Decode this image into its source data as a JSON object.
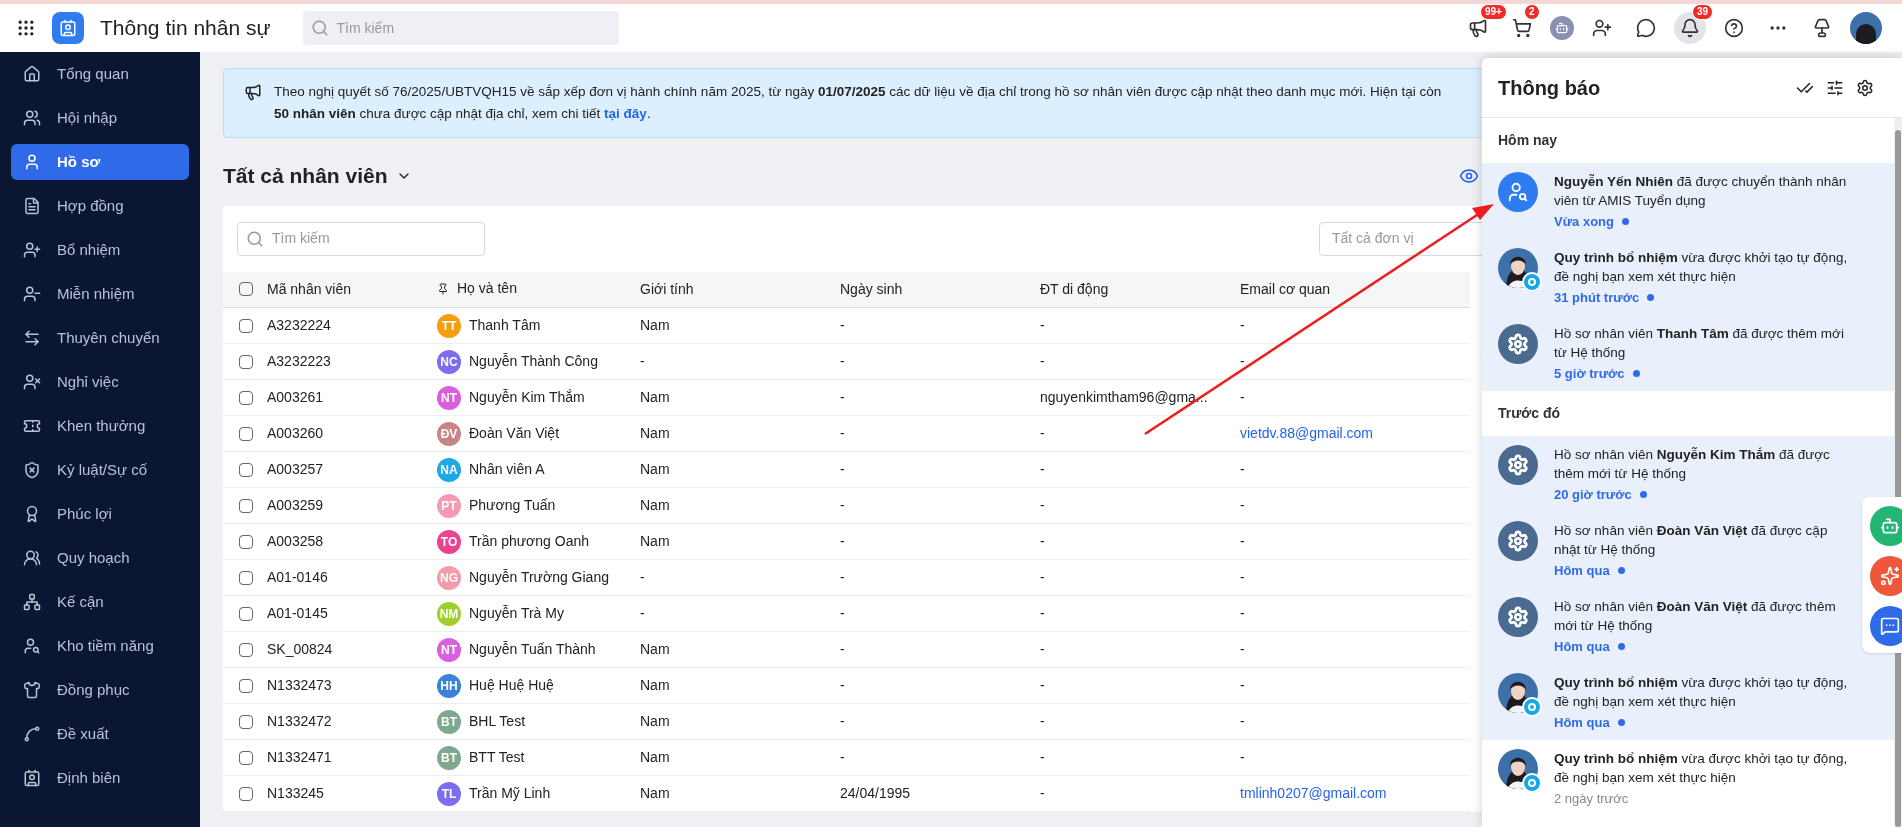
{
  "app": {
    "title": "Thông tin nhân sự",
    "search_placeholder": "Tìm kiếm"
  },
  "top_badges": {
    "announcements": "99+",
    "cart": "2",
    "notifications": "39"
  },
  "sidebar": {
    "items": [
      {
        "label": "Tổng quan",
        "selected": false
      },
      {
        "label": "Hội nhập",
        "selected": false
      },
      {
        "label": "Hồ sơ",
        "selected": true
      },
      {
        "label": "Hợp đồng",
        "selected": false
      },
      {
        "label": "Bổ nhiệm",
        "selected": false
      },
      {
        "label": "Miễn nhiệm",
        "selected": false
      },
      {
        "label": "Thuyên chuyển",
        "selected": false
      },
      {
        "label": "Nghỉ việc",
        "selected": false
      },
      {
        "label": "Khen thưởng",
        "selected": false
      },
      {
        "label": "Kỷ luật/Sự cố",
        "selected": false
      },
      {
        "label": "Phúc lợi",
        "selected": false
      },
      {
        "label": "Quy hoạch",
        "selected": false
      },
      {
        "label": "Kế cận",
        "selected": false
      },
      {
        "label": "Kho tiềm năng",
        "selected": false
      },
      {
        "label": "Đồng phục",
        "selected": false
      },
      {
        "label": "Đề xuất",
        "selected": false
      },
      {
        "label": "Định biên",
        "selected": false
      }
    ]
  },
  "banner": {
    "text": "Theo nghị quyết số 76/2025/UBTVQH15 về sắp xếp đơn vị hành chính năm 2025, từ ngày **01/07/2025** các dữ liệu về địa chỉ trong hồ sơ nhân viên được cập nhật theo danh mục mới. Hiện tại còn **50 nhân viên** chưa được cập nhật địa chỉ, xem chi tiết",
    "link": "tại đây",
    "end": "."
  },
  "view": {
    "title": "Tất cả nhân viên",
    "search_placeholder": "Tìm kiếm",
    "unit_filter": "Tất cả đơn vị"
  },
  "table": {
    "all_checked": false,
    "columns": [
      "Mã nhân viên",
      "Họ và tên",
      "Giới tính",
      "Ngày sinh",
      "ĐT di động",
      "Email cơ quan"
    ],
    "rows": [
      {
        "checked": false,
        "code": "A3232224",
        "initials": "TT",
        "color": "#f59e0b",
        "name": "Thanh Tâm",
        "gender": "Nam",
        "birth": "-",
        "phone": "-",
        "email": "-",
        "email_link": false
      },
      {
        "checked": false,
        "code": "A3232223",
        "initials": "NC",
        "color": "#7c6cf0",
        "name": "Nguyễn Thành Công",
        "gender": "-",
        "birth": "-",
        "phone": "-",
        "email": "-",
        "email_link": false
      },
      {
        "checked": false,
        "code": "A003261",
        "initials": "NT",
        "color": "#d95fe0",
        "name": "Nguyễn Kim Thắm",
        "gender": "Nam",
        "birth": "-",
        "phone": "nguyenkimtham96@gma...",
        "email": "-",
        "email_link": false
      },
      {
        "checked": false,
        "code": "A003260",
        "initials": "ĐV",
        "color": "#c98484",
        "name": "Đoàn Văn Việt",
        "gender": "Nam",
        "birth": "-",
        "phone": "-",
        "email": "vietdv.88@gmail.com",
        "email_link": true
      },
      {
        "checked": false,
        "code": "A003257",
        "initials": "NA",
        "color": "#1fa8e8",
        "name": "Nhân viên A",
        "gender": "Nam",
        "birth": "-",
        "phone": "-",
        "email": "-",
        "email_link": false
      },
      {
        "checked": false,
        "code": "A003259",
        "initials": "PT",
        "color": "#f49ab2",
        "name": "Phương Tuấn",
        "gender": "Nam",
        "birth": "-",
        "phone": "-",
        "email": "-",
        "email_link": false
      },
      {
        "checked": false,
        "code": "A003258",
        "initials": "TO",
        "color": "#e9448f",
        "name": "Trần phương Oanh",
        "gender": "Nam",
        "birth": "-",
        "phone": "-",
        "email": "-",
        "email_link": false
      },
      {
        "checked": false,
        "code": "A01-0146",
        "initials": "NG",
        "color": "#f59aa8",
        "name": "Nguyễn Trường Giang",
        "gender": "-",
        "birth": "-",
        "phone": "-",
        "email": "-",
        "email_link": false
      },
      {
        "checked": false,
        "code": "A01-0145",
        "initials": "NM",
        "color": "#9fcf2c",
        "name": "Nguyễn Trà My",
        "gender": "-",
        "birth": "-",
        "phone": "-",
        "email": "-",
        "email_link": false
      },
      {
        "checked": false,
        "code": "SK_00824",
        "initials": "NT",
        "color": "#d95fe0",
        "name": "Nguyễn Tuấn Thành",
        "gender": "Nam",
        "birth": "-",
        "phone": "-",
        "email": "-",
        "email_link": false
      },
      {
        "checked": false,
        "code": "N1332473",
        "initials": "HH",
        "color": "#3b82d9",
        "name": "Huệ Huệ Huệ",
        "gender": "Nam",
        "birth": "-",
        "phone": "-",
        "email": "-",
        "email_link": false
      },
      {
        "checked": false,
        "code": "N1332472",
        "initials": "BT",
        "color": "#7fa88f",
        "name": "BHL Test",
        "gender": "Nam",
        "birth": "-",
        "phone": "-",
        "email": "-",
        "email_link": false
      },
      {
        "checked": false,
        "code": "N1332471",
        "initials": "BT",
        "color": "#7fa88f",
        "name": "BTT Test",
        "gender": "Nam",
        "birth": "-",
        "phone": "-",
        "email": "-",
        "email_link": false
      },
      {
        "checked": false,
        "code": "N133245",
        "initials": "TL",
        "color": "#7c6cf0",
        "name": "Trần Mỹ Linh",
        "gender": "Nam",
        "birth": "24/04/1995",
        "phone": "-",
        "email": "tmlinh0207@gmail.com",
        "email_link": true
      }
    ]
  },
  "notifications": {
    "title": "Thông báo",
    "sections": [
      {
        "title": "Hôm nay",
        "items": [
          {
            "kind": "profile",
            "text": "**Nguyễn Yến Nhiên** đã được chuyển thành nhân viên từ AMIS Tuyển dụng",
            "time": "Vừa xong",
            "unread": true
          },
          {
            "text": "**Quy trình bổ nhiệm** vừa được khởi tạo tự động, đề nghị bạn xem xét thực hiện",
            "time": "31 phút trước",
            "unread": true
          },
          {
            "kind": "system",
            "text": "Hồ sơ nhân viên **Thanh Tâm** đã được thêm mới từ Hệ thống",
            "time": "5 giờ trước",
            "unread": true
          }
        ]
      },
      {
        "title": "Trước đó",
        "items": [
          {
            "kind": "system",
            "text": "Hồ sơ nhân viên **Nguyễn Kim Thắm** đã được thêm mới từ Hệ thống",
            "time": "20 giờ trước",
            "unread": true
          },
          {
            "kind": "system",
            "text": "Hồ sơ nhân viên **Đoàn Văn Việt** đã được cập nhật từ Hệ thống",
            "time": "Hôm qua",
            "unread": true
          },
          {
            "kind": "system",
            "text": "Hồ sơ nhân viên **Đoàn Văn Việt** đã được thêm mới từ Hệ thống",
            "time": "Hôm qua",
            "unread": true
          },
          {
            "text": "**Quy trình bổ nhiệm** vừa được khởi tạo tự động, đề nghị bạn xem xét thực hiện",
            "time": "Hôm qua",
            "unread": true
          },
          {
            "text": "**Quy trình bổ nhiệm** vừa được khởi tạo tự động, đề nghị bạn xem xét thực hiện",
            "time": "2 ngày trước",
            "unread": false
          }
        ]
      }
    ]
  }
}
